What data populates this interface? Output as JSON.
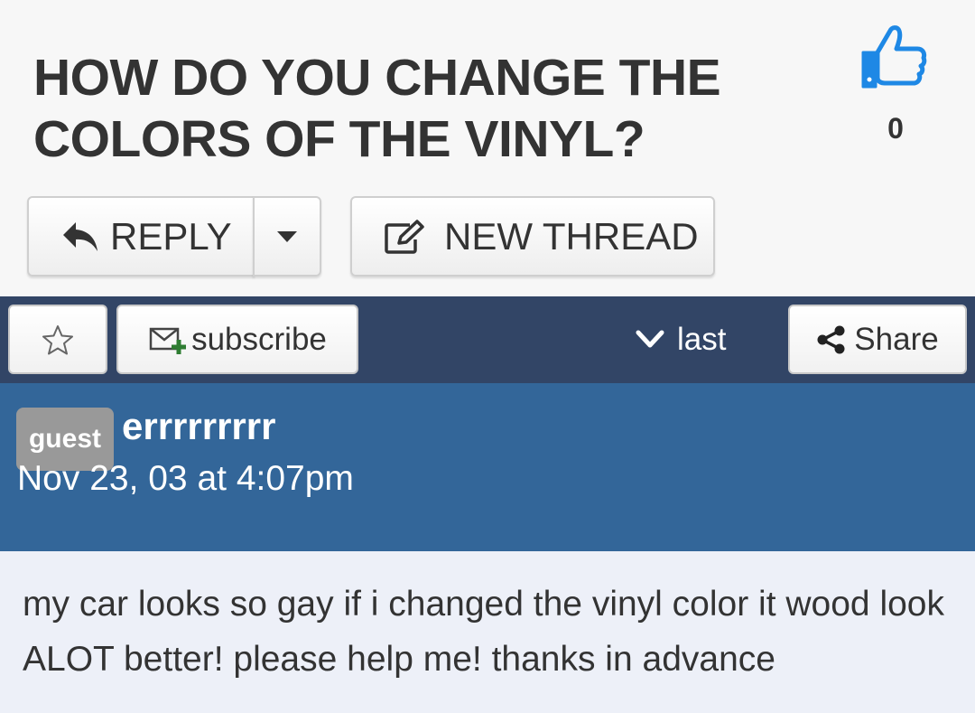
{
  "thread": {
    "title": "HOW DO YOU CHANGE THE COLORS OF THE VINYL?",
    "like_count": "0"
  },
  "actions": {
    "reply_label": "REPLY",
    "new_thread_label": "NEW THREAD"
  },
  "toolbar": {
    "subscribe_label": "subscribe",
    "last_label": "last",
    "share_label": "Share"
  },
  "post": {
    "badge": "guest",
    "username": "errrrrrrrr",
    "date": "Nov 23, 03 at 4:07pm",
    "body": "my car looks so gay if i changed the vinyl color it wood look ALOT better! please help me! thanks in advance"
  },
  "colors": {
    "page_bg": "#f7f7f7",
    "toolbar_bg": "#324566",
    "post_header_bg": "#336699",
    "post_body_bg": "#edf0f8",
    "like_icon": "#1e88e5",
    "subscribe_plus": "#2e7d32"
  },
  "icons": [
    "thumbs-up-icon",
    "reply-arrow-icon",
    "caret-down-icon",
    "edit-icon",
    "star-icon",
    "mail-plus-icon",
    "chevron-down-icon",
    "share-icon"
  ]
}
